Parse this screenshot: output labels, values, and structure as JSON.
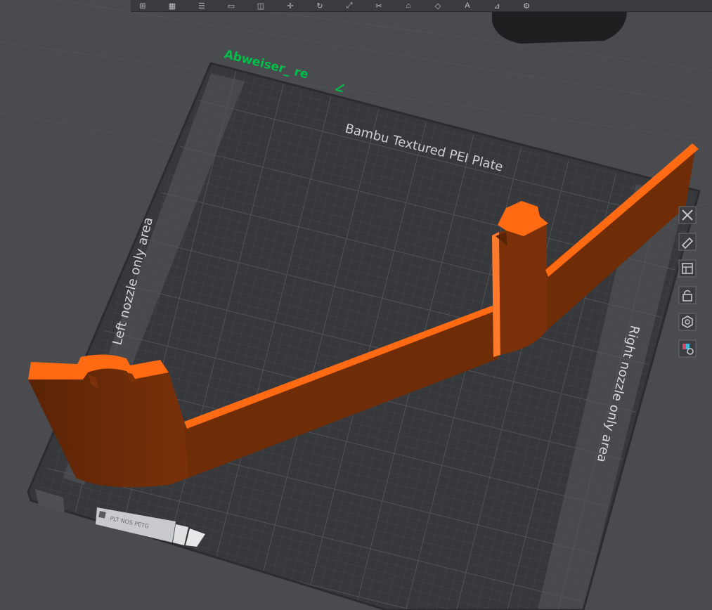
{
  "plate": {
    "name": "Abweiser_ re",
    "plate_type": "Bambu Textured PEI Plate",
    "left_area_label": "Left nozzle only area",
    "right_area_label": "Right nozzle only area",
    "plate_tag": "PLT NOS PETG"
  },
  "colors": {
    "background": "#4a4b4e",
    "plate": "#38393c",
    "grid": "#4c4d51",
    "model_orange": "#ff6a13",
    "model_shadow": "#6a2a08",
    "plate_name": "#00c04b"
  },
  "toolbar": {
    "icons": [
      "add-object-icon",
      "layout-icon",
      "split-icon",
      "arrange-icon",
      "orient-icon",
      "move-icon",
      "rotate-icon",
      "scale-icon",
      "cut-icon",
      "support-icon",
      "seam-icon",
      "text-icon",
      "measure-icon",
      "assemble-icon"
    ]
  },
  "side_tools": {
    "icons": [
      "close-icon",
      "edit-icon",
      "layers-icon",
      "lock-icon",
      "settings-icon",
      "filament-icon"
    ]
  }
}
